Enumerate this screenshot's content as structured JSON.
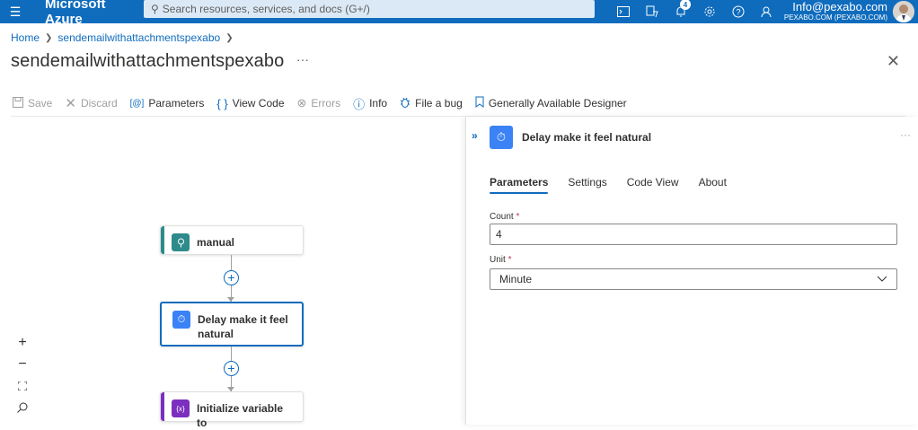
{
  "app": {
    "brand": "Microsoft Azure",
    "search_placeholder": "Search resources, services, and docs (G+/)",
    "notification_count": "4",
    "account_name": "Info@pexabo.com",
    "account_directory": "PEXABO.COM (PEXABO.COM)"
  },
  "breadcrumb": {
    "home": "Home",
    "current": "sendemailwithattachmentspexabo"
  },
  "page": {
    "title": "sendemailwithattachmentspexabo",
    "more": "···",
    "close": "✕"
  },
  "toolbar": {
    "save": "Save",
    "discard": "Discard",
    "parameters": "Parameters",
    "view_code": "View Code",
    "errors": "Errors",
    "info": "Info",
    "file_bug": "File a bug",
    "designer": "Generally Available Designer"
  },
  "canvas": {
    "nodes": [
      {
        "label": "manual",
        "color": "#2e8b8b"
      },
      {
        "label": "Delay make it feel natural",
        "color": "#3b82f6"
      },
      {
        "label": "Initialize variable to",
        "color": "#7b2fbf"
      }
    ],
    "zoom": {
      "in": "+",
      "out": "−"
    }
  },
  "panel": {
    "title": "Delay make it feel natural",
    "tabs": [
      "Parameters",
      "Settings",
      "Code View",
      "About"
    ],
    "active_tab": "Parameters",
    "count_label": "Count",
    "count_value": "4",
    "unit_label": "Unit",
    "unit_value": "Minute",
    "required_marker": "*"
  }
}
